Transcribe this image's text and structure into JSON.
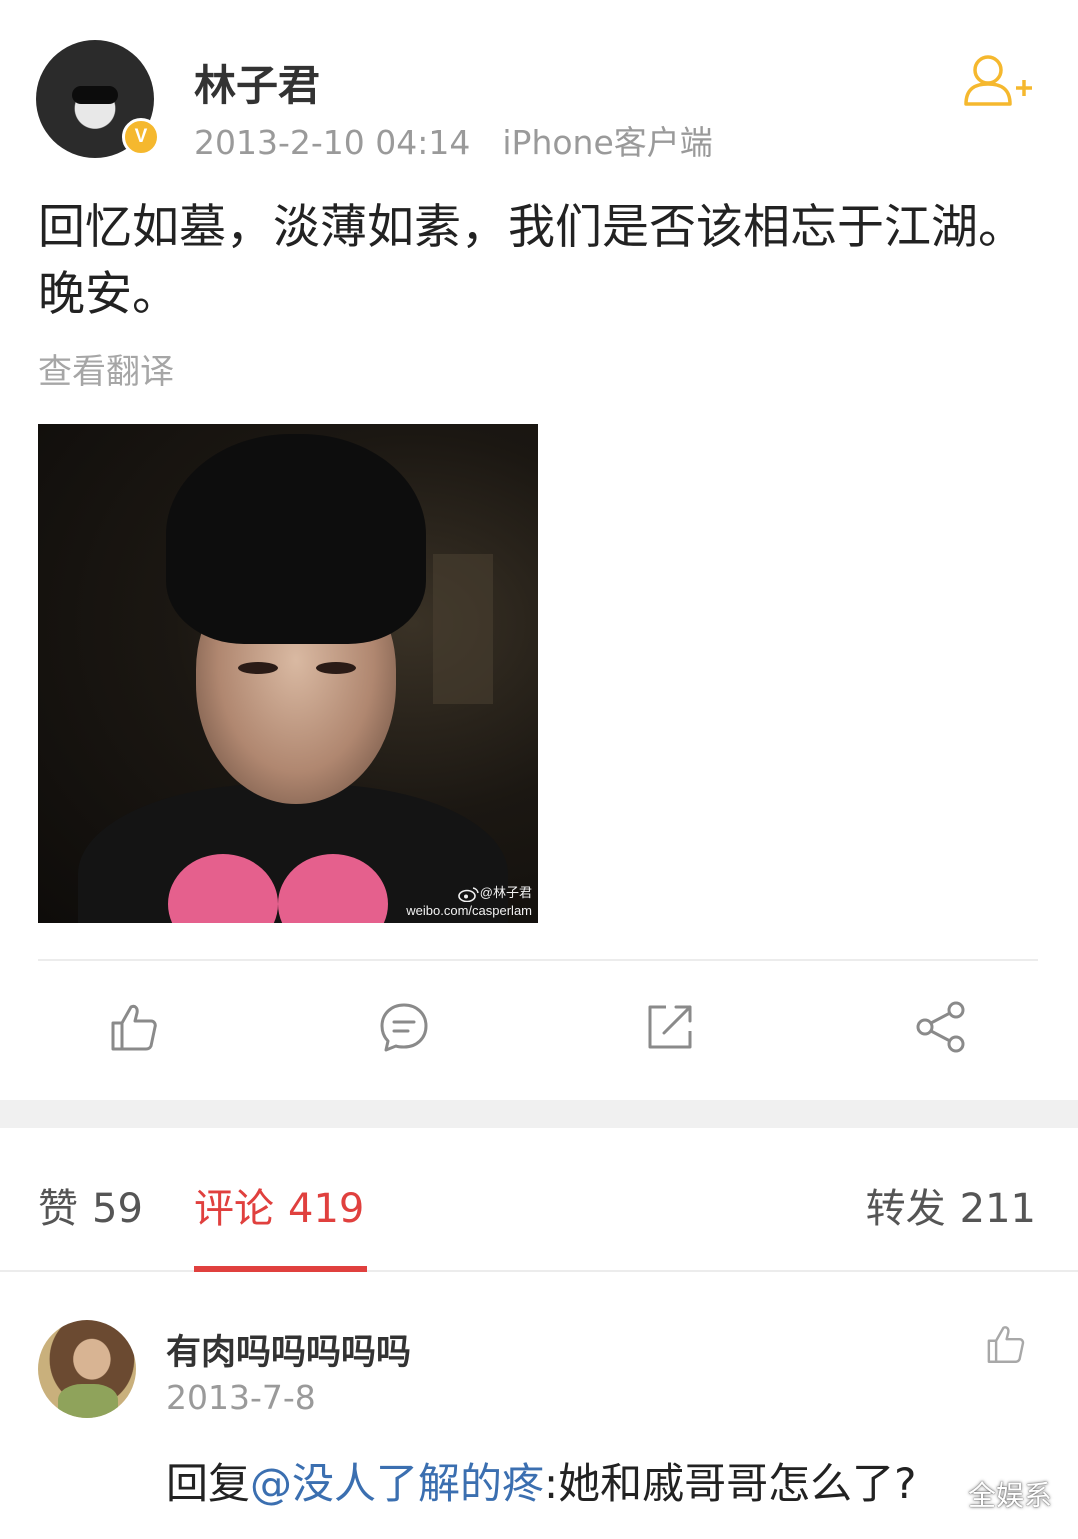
{
  "post": {
    "author": "林子君",
    "verified_badge": "V",
    "timestamp": "2013-2-10 04:14",
    "source": "iPhone客户端",
    "text": "回忆如墓，淡薄如素，我们是否该相忘于江湖。晚安。",
    "translate_label": "查看翻译",
    "image_watermark": {
      "handle": "@林子君",
      "url": "weibo.com/casperlam"
    }
  },
  "tabs": {
    "likes": {
      "label": "赞",
      "count": "59"
    },
    "comments": {
      "label": "评论",
      "count": "419"
    },
    "reposts": {
      "label": "转发",
      "count": "211"
    }
  },
  "comment": {
    "name": "有肉吗吗吗吗吗",
    "date": "2013-7-8",
    "reply_prefix": "回复",
    "mention": "@没人了解的疼",
    "text": ":她和戚哥哥怎么了?"
  },
  "brand_watermark": "全娱系",
  "colors": {
    "accent_red": "#e0403e",
    "follow_orange": "#f5b82e",
    "mention_blue": "#3b6fb0",
    "meta_gray": "#9a9a9a"
  },
  "icons": {
    "follow": "add-user-icon",
    "like": "thumbs-up-icon",
    "comment": "comment-bubble-icon",
    "repost": "repost-arrow-icon",
    "share": "share-icon"
  }
}
